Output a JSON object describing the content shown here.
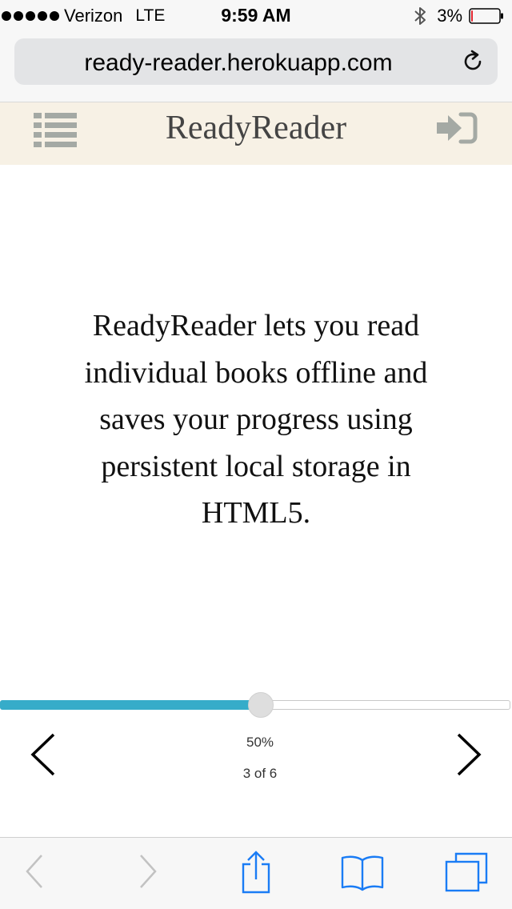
{
  "status_bar": {
    "carrier": "Verizon",
    "network": "LTE",
    "time": "9:59 AM",
    "battery_percent": "3%",
    "battery_level": 0.03,
    "icons": [
      "signal-dots-icon",
      "bluetooth-icon",
      "battery-icon"
    ]
  },
  "browser": {
    "url": "ready-reader.herokuapp.com",
    "icons": [
      "reload-icon"
    ]
  },
  "app_header": {
    "title": "ReadyReader",
    "icons": [
      "menu-list-icon",
      "sign-in-icon"
    ]
  },
  "content": {
    "text": "ReadyReader lets you read individual books offline and saves your progress using persistent local storage in HTML5."
  },
  "reader": {
    "progress_fraction": 0.5,
    "percent_label": "50%",
    "page_label": "3 of 6",
    "icons": [
      "chevron-left-icon",
      "chevron-right-icon"
    ]
  },
  "toolbar": {
    "icons": [
      "back-icon",
      "forward-icon",
      "share-icon",
      "bookmarks-icon",
      "tabs-icon"
    ]
  },
  "colors": {
    "accent": "#36acc9",
    "ios_blue": "#1a7cf5",
    "header_bg": "#f7f1e5",
    "battery_low": "#e3262f"
  }
}
